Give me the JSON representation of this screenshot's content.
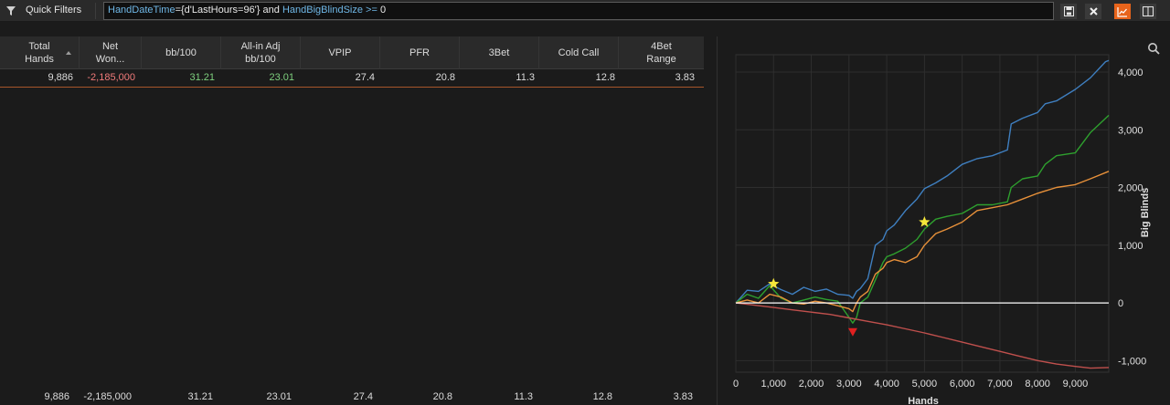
{
  "toolbar": {
    "quick_filters_label": "Quick Filters",
    "filter": {
      "key1": "HandDateTime",
      "text1": "={d'LastHours=96'} and ",
      "key2": "HandBigBlindSize",
      "op": " >= ",
      "value": "0"
    },
    "buttons": {
      "save_icon": "save-icon",
      "clear_icon": "close-icon",
      "graph_icon": "line-chart-icon",
      "layout_icon": "panel-layout-icon"
    },
    "colors": {
      "accent": "#e8641b",
      "filter_keyword": "#6fb7e6"
    }
  },
  "table": {
    "columns": [
      {
        "line1": "Total",
        "line2": "Hands"
      },
      {
        "line1": "Net",
        "line2": "Won..."
      },
      {
        "line1": "bb/100",
        "line2": ""
      },
      {
        "line1": "All-in Adj",
        "line2": "bb/100"
      },
      {
        "line1": "VPIP",
        "line2": ""
      },
      {
        "line1": "PFR",
        "line2": ""
      },
      {
        "line1": "3Bet",
        "line2": ""
      },
      {
        "line1": "Cold Call",
        "line2": ""
      },
      {
        "line1": "4Bet",
        "line2": "Range"
      }
    ],
    "row": [
      "9,886",
      "-2,185,000",
      "31.21",
      "23.01",
      "27.4",
      "20.8",
      "11.3",
      "12.8",
      "3.83"
    ],
    "totals": [
      "9,886",
      "-2,185,000",
      "31.21",
      "23.01",
      "27.4",
      "20.8",
      "11.3",
      "12.8",
      "3.83"
    ]
  },
  "chart_data": {
    "type": "line",
    "xlabel": "Hands",
    "ylabel": "Big Blinds",
    "xlim": [
      0,
      9886
    ],
    "ylim": [
      -1200,
      4300
    ],
    "x_ticks": [
      "0",
      "1,000",
      "2,000",
      "3,000",
      "4,000",
      "5,000",
      "6,000",
      "7,000",
      "8,000",
      "9,000"
    ],
    "y_ticks": [
      "-1,000",
      "0",
      "1,000",
      "2,000",
      "3,000",
      "4,000"
    ],
    "zoom_icon": "zoom-icon",
    "series": [
      {
        "color": "#3f7fc0",
        "x": [
          0,
          300,
          600,
          900,
          1200,
          1500,
          1800,
          2100,
          2400,
          2700,
          3000,
          3100,
          3200,
          3300,
          3500,
          3700,
          3900,
          4000,
          4200,
          4500,
          4800,
          5000,
          5300,
          5600,
          6000,
          6400,
          6800,
          7200,
          7300,
          7600,
          8000,
          8200,
          8500,
          9000,
          9400,
          9800,
          9886
        ],
        "y": [
          0,
          220,
          200,
          330,
          230,
          150,
          270,
          200,
          240,
          150,
          130,
          80,
          200,
          250,
          420,
          1000,
          1100,
          1250,
          1350,
          1600,
          1800,
          1980,
          2080,
          2200,
          2400,
          2500,
          2550,
          2650,
          3100,
          3200,
          3300,
          3450,
          3500,
          3700,
          3900,
          4180,
          4200
        ]
      },
      {
        "color": "#2ea02e",
        "x": [
          0,
          300,
          600,
          900,
          1200,
          1500,
          1800,
          2100,
          2400,
          2700,
          3000,
          3100,
          3200,
          3300,
          3500,
          3700,
          3900,
          4000,
          4200,
          4500,
          4800,
          5000,
          5300,
          5600,
          6000,
          6400,
          6800,
          7200,
          7300,
          7600,
          8000,
          8200,
          8500,
          9000,
          9400,
          9886
        ],
        "y": [
          0,
          150,
          80,
          300,
          80,
          0,
          50,
          100,
          60,
          30,
          -250,
          -350,
          -250,
          0,
          100,
          400,
          700,
          800,
          850,
          950,
          1100,
          1280,
          1450,
          1500,
          1550,
          1700,
          1700,
          1750,
          2000,
          2150,
          2200,
          2400,
          2550,
          2600,
          2950,
          3250
        ]
      },
      {
        "color": "#e8913a",
        "x": [
          0,
          300,
          600,
          900,
          1200,
          1500,
          1800,
          2100,
          2400,
          2700,
          3000,
          3100,
          3200,
          3300,
          3500,
          3700,
          3900,
          4000,
          4200,
          4500,
          4800,
          5000,
          5300,
          5600,
          6000,
          6400,
          6800,
          7200,
          7600,
          8000,
          8500,
          9000,
          9400,
          9886
        ],
        "y": [
          0,
          50,
          0,
          150,
          100,
          0,
          -20,
          30,
          0,
          -50,
          -100,
          -150,
          0,
          100,
          200,
          500,
          600,
          700,
          750,
          700,
          800,
          1000,
          1200,
          1280,
          1400,
          1600,
          1650,
          1700,
          1800,
          1900,
          2000,
          2050,
          2150,
          2280
        ]
      },
      {
        "color": "#c0504d",
        "x": [
          0,
          500,
          1000,
          1500,
          2000,
          2500,
          3000,
          3500,
          4000,
          4500,
          5000,
          5500,
          6000,
          6500,
          7000,
          7500,
          8000,
          8500,
          9000,
          9400,
          9886
        ],
        "y": [
          0,
          -40,
          -80,
          -120,
          -160,
          -200,
          -260,
          -320,
          -380,
          -450,
          -520,
          -600,
          -680,
          -760,
          -840,
          -920,
          -1000,
          -1060,
          -1100,
          -1130,
          -1120
        ]
      },
      {
        "color": "#ffffff",
        "x": [
          0,
          9886
        ],
        "y": [
          0,
          0
        ]
      }
    ],
    "markers": [
      {
        "shape": "star",
        "color": "#f5e63a",
        "x": 1000,
        "y": 330
      },
      {
        "shape": "star",
        "color": "#f5e63a",
        "x": 5000,
        "y": 1400
      },
      {
        "shape": "triangle-down",
        "color": "#e02020",
        "x": 3100,
        "y": -500
      }
    ]
  }
}
